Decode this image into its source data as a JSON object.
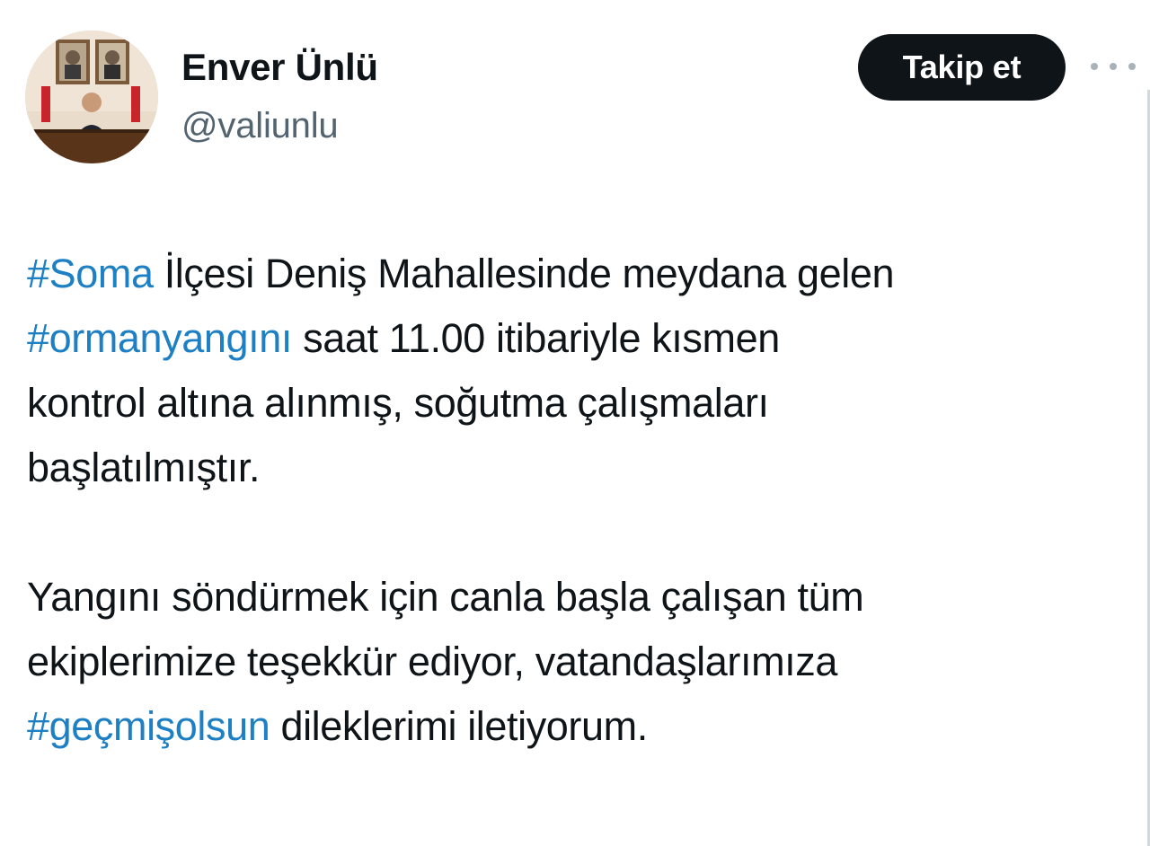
{
  "author": {
    "name": "Enver Ünlü",
    "handle": "@valiunlu"
  },
  "follow_button_label": "Takip et",
  "more_icon": "more-horizontal-icon",
  "colors": {
    "hashtag": "#1d7fc4",
    "text": "#0f1419",
    "secondary": "#536471",
    "button_bg": "#0f1419"
  },
  "tweet": {
    "p1": {
      "l1_tag": "#Soma",
      "l1_text": " İlçesi Deniş Mahallesinde meydana gelen",
      "l2_tag": "#ormanyangını",
      "l2_text": " saat 11.00 itibariyle kısmen",
      "l3_text": "kontrol altına alınmış, soğutma çalışmaları",
      "l4_text": "başlatılmıştır."
    },
    "p2": {
      "l1_text": "Yangını söndürmek için canla başla çalışan tüm",
      "l2_text": "ekiplerimize teşekkür ediyor, vatandaşlarımıza",
      "l3_tag": "#geçmişolsun",
      "l3_text": " dileklerimi iletiyorum."
    }
  }
}
